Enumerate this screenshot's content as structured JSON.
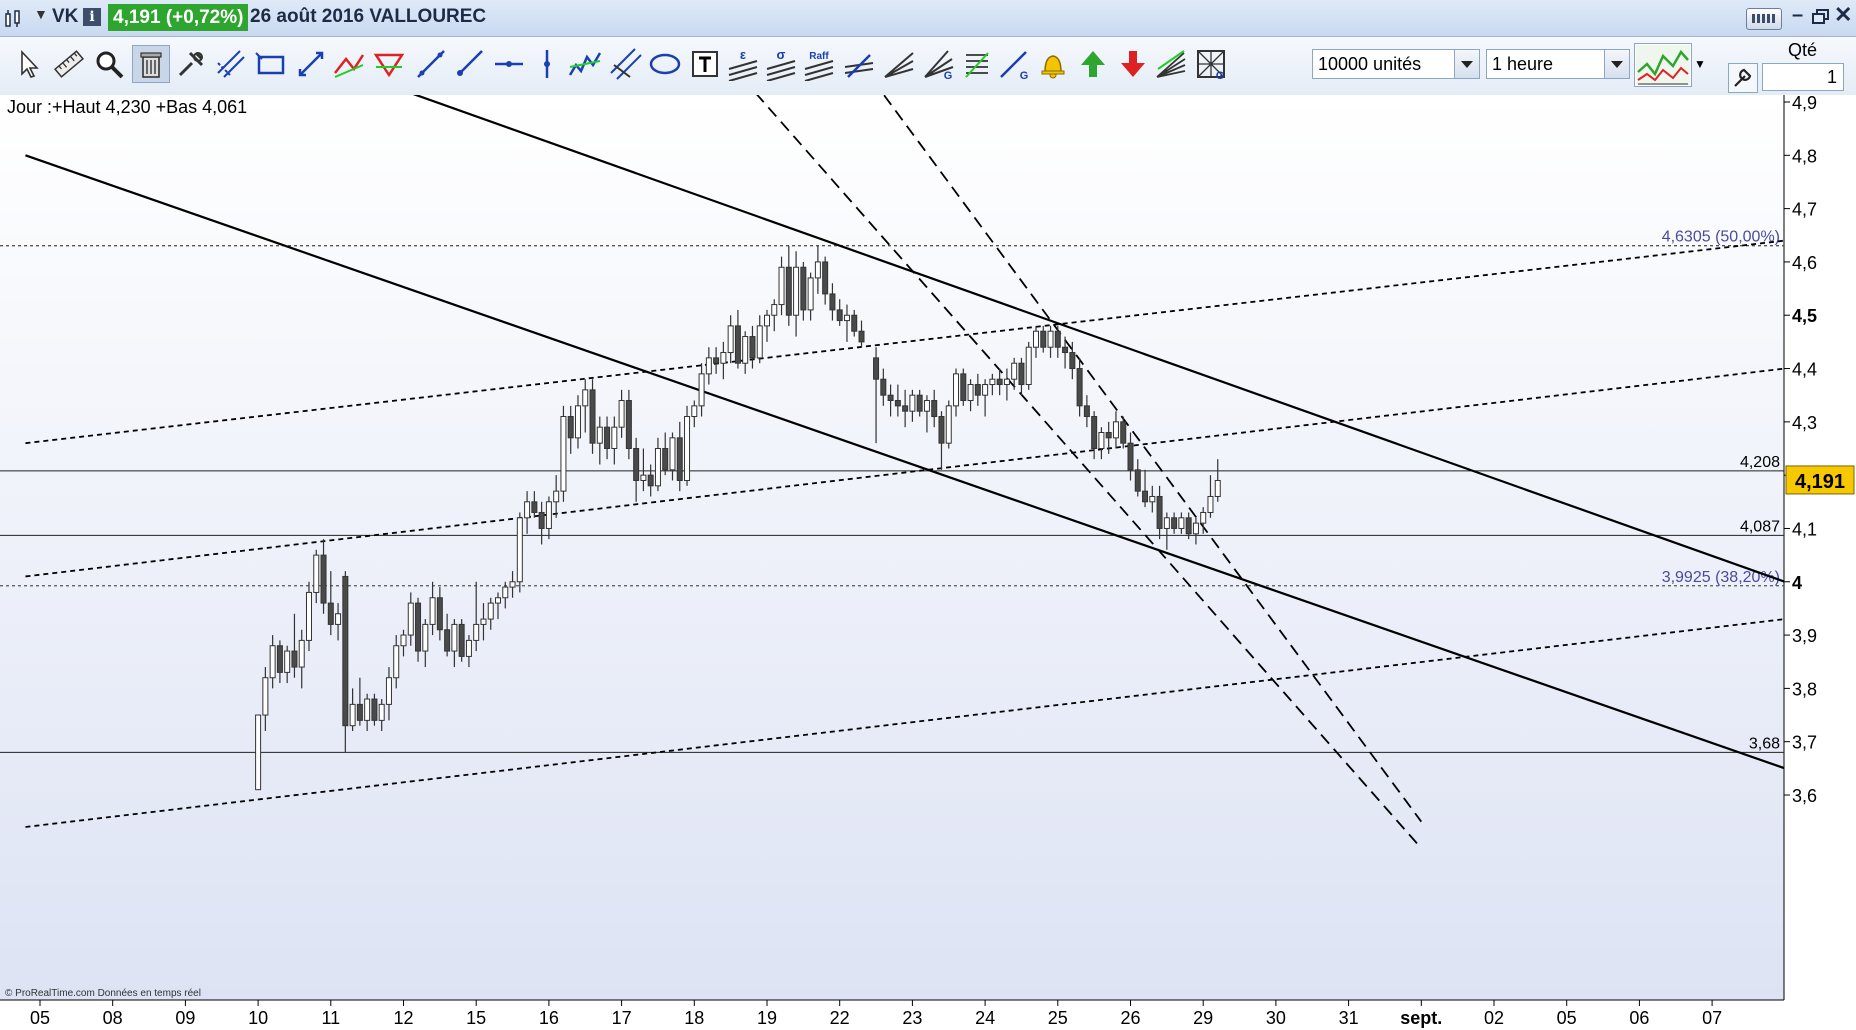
{
  "window": {
    "symbol": "VK",
    "price_badge": "4,191 (+0,72%)",
    "date_name": "26 août 2016 VALLOUREC",
    "icons": [
      "chart-window-icon",
      "dropdown-icon",
      "info-icon",
      "keyboard-icon",
      "minimize-icon",
      "restore-icon",
      "close-icon"
    ],
    "colors": {
      "badge_bg": "#2ea52e",
      "title_text": "#1d2b46"
    }
  },
  "toolbar": {
    "tools": [
      {
        "name": "pointer-tool-icon"
      },
      {
        "name": "ruler-tool-icon"
      },
      {
        "name": "zoom-tool-icon"
      },
      {
        "name": "delete-objects-icon",
        "selected": true
      },
      {
        "name": "properties-tool-icon"
      },
      {
        "name": "parallel-lines-icon"
      },
      {
        "name": "rectangle-tool-icon"
      },
      {
        "name": "diagonal-arrows-icon"
      },
      {
        "name": "trendline-red-icon"
      },
      {
        "name": "triangle-red-icon"
      },
      {
        "name": "line-tool-icon"
      },
      {
        "name": "ray-tool-icon"
      },
      {
        "name": "horizontal-line-icon"
      },
      {
        "name": "vertical-line-icon"
      },
      {
        "name": "zigzag-icon"
      },
      {
        "name": "channel-tool-icon"
      },
      {
        "name": "ellipse-tool-icon"
      },
      {
        "name": "text-tool-icon"
      },
      {
        "name": "epsilon-channel-icon",
        "label": "ε"
      },
      {
        "name": "sigma-channel-icon",
        "label": "σ"
      },
      {
        "name": "raff-channel-icon",
        "label": "Raff"
      },
      {
        "name": "fibonacci-arrow-icon"
      },
      {
        "name": "fan-tool-icon"
      },
      {
        "name": "gann-fan-icon",
        "label": "G"
      },
      {
        "name": "fib-retracement-icon"
      },
      {
        "name": "gann-line-icon",
        "label": "G"
      },
      {
        "name": "alert-bell-icon"
      },
      {
        "name": "buy-arrow-icon"
      },
      {
        "name": "sell-arrow-icon"
      },
      {
        "name": "speed-lines-icon"
      },
      {
        "name": "gann-grid-icon",
        "label": "G"
      }
    ],
    "units_select": "10000 unités",
    "period_select": "1 heure",
    "qte_label": "Qté",
    "qte_value": "1",
    "icons": [
      "indicators-icon",
      "dropdown-icon",
      "wrench-icon"
    ]
  },
  "chart": {
    "corner_text": "Jour :+Haut 4,230 +Bas 4,061",
    "watermark": "© ProRealTime.com  Données en temps réel",
    "current_price": "4,191",
    "levels": [
      {
        "value": 4.6305,
        "label": "4,6305 (50,00%)",
        "style": "fib"
      },
      {
        "value": 4.208,
        "label": "4,208",
        "style": "solid"
      },
      {
        "value": 4.087,
        "label": "4,087",
        "style": "solid"
      },
      {
        "value": 3.9925,
        "label": "3,9925 (38,20%)",
        "style": "fib"
      },
      {
        "value": 3.68,
        "label": "3,68",
        "style": "solid"
      }
    ],
    "colors": {
      "bull": "#ffffff",
      "bear": "#4a4a4a",
      "fib_label": "#4a4a9e",
      "price_box": "#f5c800",
      "bg_top": "#ffffff",
      "bg_bottom": "#dde3f4"
    }
  },
  "chart_data": {
    "type": "candlestick",
    "timeframe": "1 heure",
    "ylim": [
      3.55,
      4.95
    ],
    "y_ticks": [
      {
        "v": 4.9,
        "label": "4,9"
      },
      {
        "v": 4.8,
        "label": "4,8"
      },
      {
        "v": 4.7,
        "label": "4,7"
      },
      {
        "v": 4.6,
        "label": "4,6"
      },
      {
        "v": 4.5,
        "label": "4,5"
      },
      {
        "v": 4.4,
        "label": "4,4"
      },
      {
        "v": 4.3,
        "label": "4,3"
      },
      {
        "v": 4.2,
        "label": "4,2"
      },
      {
        "v": 4.1,
        "label": "4,1"
      },
      {
        "v": 4.0,
        "label": "4"
      },
      {
        "v": 3.9,
        "label": "3,9"
      },
      {
        "v": 3.8,
        "label": "3,8"
      },
      {
        "v": 3.7,
        "label": "3,7"
      },
      {
        "v": 3.6,
        "label": "3,6"
      }
    ],
    "x_labels": [
      "05",
      "08",
      "09",
      "10",
      "11",
      "12",
      "15",
      "16",
      "17",
      "18",
      "19",
      "22",
      "23",
      "24",
      "25",
      "26",
      "29",
      "30",
      "31",
      "sept.",
      "02",
      "05",
      "06",
      "07"
    ],
    "bar_index_range": [
      0,
      240
    ],
    "x_label_bars": [
      0,
      10,
      20,
      30,
      40,
      50,
      60,
      70,
      80,
      90,
      100,
      110,
      120,
      130,
      140,
      150,
      160,
      170,
      180,
      190,
      200,
      210,
      220,
      230
    ],
    "candles": [
      [
        30,
        3.61,
        3.75,
        3.61,
        3.75
      ],
      [
        31,
        3.75,
        3.84,
        3.72,
        3.82
      ],
      [
        32,
        3.82,
        3.9,
        3.8,
        3.88
      ],
      [
        33,
        3.88,
        3.89,
        3.81,
        3.83
      ],
      [
        34,
        3.83,
        3.88,
        3.81,
        3.87
      ],
      [
        35,
        3.87,
        3.94,
        3.82,
        3.84
      ],
      [
        36,
        3.84,
        3.91,
        3.8,
        3.89
      ],
      [
        37,
        3.89,
        4.0,
        3.87,
        3.98
      ],
      [
        38,
        3.98,
        4.06,
        3.96,
        4.05
      ],
      [
        39,
        4.05,
        4.08,
        3.94,
        3.96
      ],
      [
        40,
        3.96,
        4.02,
        3.9,
        3.92
      ],
      [
        41,
        3.92,
        3.96,
        3.89,
        3.94
      ],
      [
        42,
        4.01,
        4.02,
        3.68,
        3.73
      ],
      [
        43,
        3.73,
        3.8,
        3.72,
        3.77
      ],
      [
        44,
        3.77,
        3.82,
        3.73,
        3.74
      ],
      [
        45,
        3.74,
        3.79,
        3.72,
        3.78
      ],
      [
        46,
        3.78,
        3.79,
        3.73,
        3.74
      ],
      [
        47,
        3.74,
        3.78,
        3.72,
        3.77
      ],
      [
        48,
        3.77,
        3.84,
        3.74,
        3.82
      ],
      [
        49,
        3.82,
        3.9,
        3.8,
        3.88
      ],
      [
        50,
        3.88,
        3.91,
        3.86,
        3.9
      ],
      [
        51,
        3.9,
        3.98,
        3.88,
        3.96
      ],
      [
        52,
        3.96,
        3.97,
        3.85,
        3.87
      ],
      [
        53,
        3.87,
        3.93,
        3.84,
        3.92
      ],
      [
        54,
        3.92,
        4.0,
        3.9,
        3.97
      ],
      [
        55,
        3.97,
        3.99,
        3.89,
        3.91
      ],
      [
        56,
        3.91,
        3.94,
        3.86,
        3.87
      ],
      [
        57,
        3.87,
        3.93,
        3.84,
        3.92
      ],
      [
        58,
        3.92,
        3.93,
        3.85,
        3.86
      ],
      [
        59,
        3.86,
        3.9,
        3.84,
        3.89
      ],
      [
        60,
        3.89,
        4.0,
        3.87,
        3.92
      ],
      [
        61,
        3.92,
        3.96,
        3.89,
        3.93
      ],
      [
        62,
        3.93,
        3.97,
        3.91,
        3.96
      ],
      [
        63,
        3.96,
        3.98,
        3.93,
        3.97
      ],
      [
        64,
        3.97,
        4.0,
        3.95,
        3.99
      ],
      [
        65,
        3.99,
        4.02,
        3.97,
        4.0
      ],
      [
        66,
        4.0,
        4.13,
        3.98,
        4.12
      ],
      [
        67,
        4.12,
        4.17,
        4.09,
        4.15
      ],
      [
        68,
        4.15,
        4.17,
        4.12,
        4.13
      ],
      [
        69,
        4.13,
        4.15,
        4.07,
        4.1
      ],
      [
        70,
        4.1,
        4.16,
        4.08,
        4.15
      ],
      [
        71,
        4.15,
        4.2,
        4.12,
        4.17
      ],
      [
        72,
        4.17,
        4.33,
        4.15,
        4.31
      ],
      [
        73,
        4.31,
        4.33,
        4.24,
        4.27
      ],
      [
        74,
        4.27,
        4.35,
        4.25,
        4.33
      ],
      [
        75,
        4.33,
        4.38,
        4.28,
        4.36
      ],
      [
        76,
        4.36,
        4.38,
        4.24,
        4.26
      ],
      [
        77,
        4.26,
        4.31,
        4.22,
        4.29
      ],
      [
        78,
        4.29,
        4.31,
        4.23,
        4.25
      ],
      [
        79,
        4.25,
        4.31,
        4.22,
        4.29
      ],
      [
        80,
        4.29,
        4.36,
        4.27,
        4.34
      ],
      [
        81,
        4.34,
        4.36,
        4.23,
        4.25
      ],
      [
        82,
        4.25,
        4.27,
        4.15,
        4.19
      ],
      [
        83,
        4.19,
        4.25,
        4.17,
        4.2
      ],
      [
        84,
        4.2,
        4.22,
        4.16,
        4.18
      ],
      [
        85,
        4.18,
        4.27,
        4.17,
        4.25
      ],
      [
        86,
        4.25,
        4.28,
        4.2,
        4.21
      ],
      [
        87,
        4.21,
        4.28,
        4.19,
        4.27
      ],
      [
        88,
        4.27,
        4.3,
        4.17,
        4.19
      ],
      [
        89,
        4.19,
        4.33,
        4.18,
        4.31
      ],
      [
        90,
        4.31,
        4.34,
        4.29,
        4.33
      ],
      [
        91,
        4.33,
        4.41,
        4.31,
        4.39
      ],
      [
        92,
        4.39,
        4.44,
        4.37,
        4.42
      ],
      [
        93,
        4.42,
        4.44,
        4.39,
        4.41
      ],
      [
        94,
        4.41,
        4.45,
        4.38,
        4.43
      ],
      [
        95,
        4.43,
        4.5,
        4.41,
        4.48
      ],
      [
        96,
        4.48,
        4.51,
        4.4,
        4.41
      ],
      [
        97,
        4.41,
        4.47,
        4.39,
        4.46
      ],
      [
        98,
        4.46,
        4.48,
        4.4,
        4.42
      ],
      [
        99,
        4.42,
        4.5,
        4.41,
        4.48
      ],
      [
        100,
        4.48,
        4.51,
        4.45,
        4.5
      ],
      [
        101,
        4.5,
        4.53,
        4.47,
        4.52
      ],
      [
        102,
        4.52,
        4.61,
        4.5,
        4.59
      ],
      [
        103,
        4.59,
        4.63,
        4.48,
        4.5
      ],
      [
        104,
        4.5,
        4.62,
        4.46,
        4.59
      ],
      [
        105,
        4.59,
        4.6,
        4.49,
        4.51
      ],
      [
        106,
        4.51,
        4.58,
        4.49,
        4.57
      ],
      [
        107,
        4.57,
        4.63,
        4.54,
        4.6
      ],
      [
        108,
        4.6,
        4.61,
        4.52,
        4.54
      ],
      [
        109,
        4.54,
        4.56,
        4.49,
        4.51
      ],
      [
        110,
        4.51,
        4.53,
        4.48,
        4.49
      ],
      [
        111,
        4.49,
        4.52,
        4.45,
        4.5
      ],
      [
        112,
        4.5,
        4.51,
        4.46,
        4.47
      ],
      [
        113,
        4.47,
        4.49,
        4.44,
        4.45
      ],
      [
        115,
        4.42,
        4.44,
        4.26,
        4.38
      ],
      [
        116,
        4.38,
        4.4,
        4.33,
        4.35
      ],
      [
        117,
        4.35,
        4.37,
        4.31,
        4.34
      ],
      [
        118,
        4.34,
        4.37,
        4.31,
        4.33
      ],
      [
        119,
        4.33,
        4.36,
        4.29,
        4.32
      ],
      [
        120,
        4.32,
        4.36,
        4.3,
        4.35
      ],
      [
        121,
        4.35,
        4.36,
        4.31,
        4.32
      ],
      [
        122,
        4.32,
        4.35,
        4.28,
        4.34
      ],
      [
        123,
        4.34,
        4.36,
        4.29,
        4.31
      ],
      [
        124,
        4.31,
        4.32,
        4.21,
        4.26
      ],
      [
        125,
        4.26,
        4.34,
        4.25,
        4.33
      ],
      [
        126,
        4.33,
        4.4,
        4.31,
        4.39
      ],
      [
        127,
        4.39,
        4.4,
        4.33,
        4.34
      ],
      [
        128,
        4.34,
        4.38,
        4.32,
        4.37
      ],
      [
        129,
        4.37,
        4.39,
        4.33,
        4.35
      ],
      [
        130,
        4.35,
        4.38,
        4.31,
        4.37
      ],
      [
        131,
        4.37,
        4.39,
        4.35,
        4.38
      ],
      [
        132,
        4.38,
        4.4,
        4.35,
        4.37
      ],
      [
        133,
        4.37,
        4.4,
        4.34,
        4.38
      ],
      [
        134,
        4.38,
        4.42,
        4.36,
        4.41
      ],
      [
        135,
        4.41,
        4.42,
        4.35,
        4.37
      ],
      [
        136,
        4.37,
        4.45,
        4.36,
        4.44
      ],
      [
        137,
        4.44,
        4.48,
        4.42,
        4.47
      ],
      [
        138,
        4.47,
        4.48,
        4.43,
        4.44
      ],
      [
        139,
        4.44,
        4.48,
        4.42,
        4.47
      ],
      [
        140,
        4.47,
        4.48,
        4.42,
        4.44
      ],
      [
        141,
        4.44,
        4.46,
        4.4,
        4.43
      ],
      [
        142,
        4.43,
        4.45,
        4.38,
        4.4
      ],
      [
        143,
        4.4,
        4.42,
        4.31,
        4.33
      ],
      [
        144,
        4.33,
        4.35,
        4.29,
        4.31
      ],
      [
        145,
        4.31,
        4.32,
        4.23,
        4.25
      ],
      [
        146,
        4.25,
        4.29,
        4.23,
        4.28
      ],
      [
        147,
        4.28,
        4.3,
        4.24,
        4.27
      ],
      [
        148,
        4.27,
        4.32,
        4.25,
        4.3
      ],
      [
        149,
        4.3,
        4.31,
        4.25,
        4.26
      ],
      [
        150,
        4.26,
        4.28,
        4.19,
        4.21
      ],
      [
        151,
        4.21,
        4.23,
        4.16,
        4.17
      ],
      [
        152,
        4.17,
        4.21,
        4.14,
        4.15
      ],
      [
        153,
        4.15,
        4.18,
        4.13,
        4.16
      ],
      [
        154,
        4.16,
        4.18,
        4.08,
        4.1
      ],
      [
        155,
        4.1,
        4.13,
        4.06,
        4.12
      ],
      [
        156,
        4.12,
        4.13,
        4.09,
        4.1
      ],
      [
        157,
        4.1,
        4.13,
        4.09,
        4.12
      ],
      [
        158,
        4.12,
        4.13,
        4.08,
        4.09
      ],
      [
        159,
        4.09,
        4.12,
        4.07,
        4.11
      ],
      [
        160,
        4.11,
        4.14,
        4.09,
        4.13
      ],
      [
        161,
        4.13,
        4.2,
        4.12,
        4.16
      ],
      [
        162,
        4.16,
        4.23,
        4.15,
        4.19
      ]
    ],
    "trendlines": [
      {
        "style": "solid",
        "from": [
          -2,
          4.8
        ],
        "to": [
          240,
          3.65
        ]
      },
      {
        "style": "solid",
        "from": [
          40,
          4.97
        ],
        "to": [
          240,
          4.0
        ]
      },
      {
        "style": "dashed",
        "from": [
          95,
          4.97
        ],
        "to": [
          190,
          3.5
        ]
      },
      {
        "style": "dashed",
        "from": [
          113,
          4.97
        ],
        "to": [
          190,
          3.55
        ]
      },
      {
        "style": "dotted",
        "from": [
          -2,
          4.26
        ],
        "to": [
          240,
          4.64
        ]
      },
      {
        "style": "dotted",
        "from": [
          -2,
          4.01
        ],
        "to": [
          240,
          4.4
        ]
      },
      {
        "style": "dotted",
        "from": [
          -2,
          3.54
        ],
        "to": [
          240,
          3.93
        ]
      }
    ]
  }
}
